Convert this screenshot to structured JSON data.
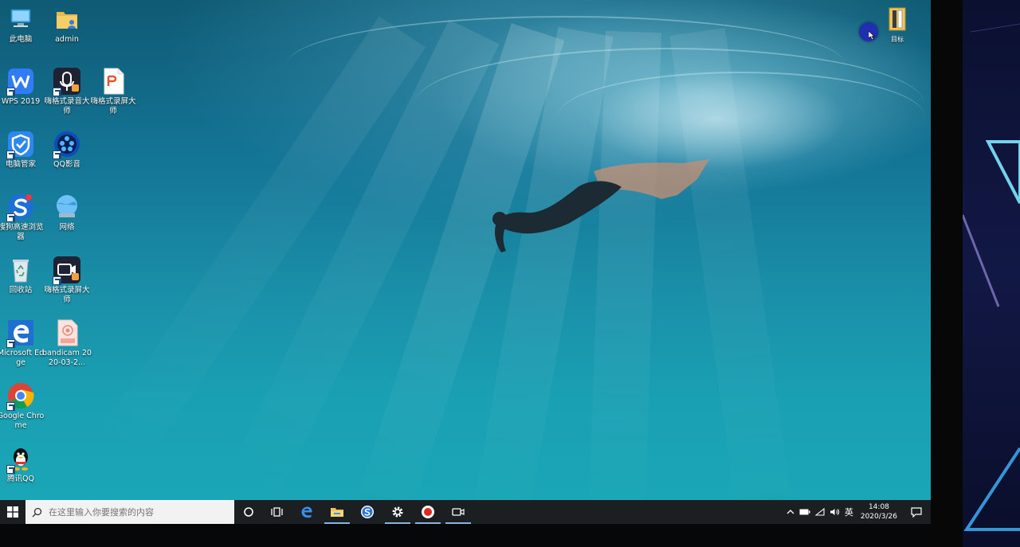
{
  "desktop": {
    "icons": [
      {
        "label": "此电脑",
        "icon": "this-pc-icon"
      },
      {
        "label": "admin",
        "icon": "user-folder-icon"
      },
      {
        "label": "WPS 2019",
        "icon": "wps-icon"
      },
      {
        "label": "嗨格式录音大师",
        "icon": "audio-recorder-icon"
      },
      {
        "label": "嗨格式录屏大师",
        "icon": "pdf-doc-icon"
      },
      {
        "label": "电脑管家",
        "icon": "pc-manager-icon"
      },
      {
        "label": "QQ影音",
        "icon": "qq-player-icon"
      },
      {
        "label": "搜狗高速浏览器",
        "icon": "sogou-browser-icon"
      },
      {
        "label": "网络",
        "icon": "network-icon"
      },
      {
        "label": "回收站",
        "icon": "recycle-bin-icon"
      },
      {
        "label": "嗨格式录屏大师",
        "icon": "screen-recorder-icon"
      },
      {
        "label": "Microsoft Edge",
        "icon": "edge-icon"
      },
      {
        "label": "bandicam 2020-03-2...",
        "icon": "mp4-file-icon"
      },
      {
        "label": "Google Chrome",
        "icon": "chrome-icon"
      },
      {
        "label": "腾讯QQ",
        "icon": "qq-icon"
      },
      {
        "label": "目标",
        "icon": "folder-book-icon"
      }
    ]
  },
  "taskbar": {
    "search_placeholder": "在这里输入你要搜索的内容",
    "pinned": [
      "cortana-icon",
      "task-view-icon",
      "edge-icon",
      "file-explorer-icon",
      "sogou-browser-icon",
      "settings-icon",
      "record-icon",
      "camera-icon"
    ],
    "tray": {
      "ime": "英",
      "time": "14:08",
      "date": "2020/3/26"
    }
  },
  "colors": {
    "taskbar_bg": "#1c1f22",
    "ocean_top": "#0f5a74",
    "ocean_bottom": "#1aa6b6",
    "cursor_highlight": "#1f2fb0"
  }
}
